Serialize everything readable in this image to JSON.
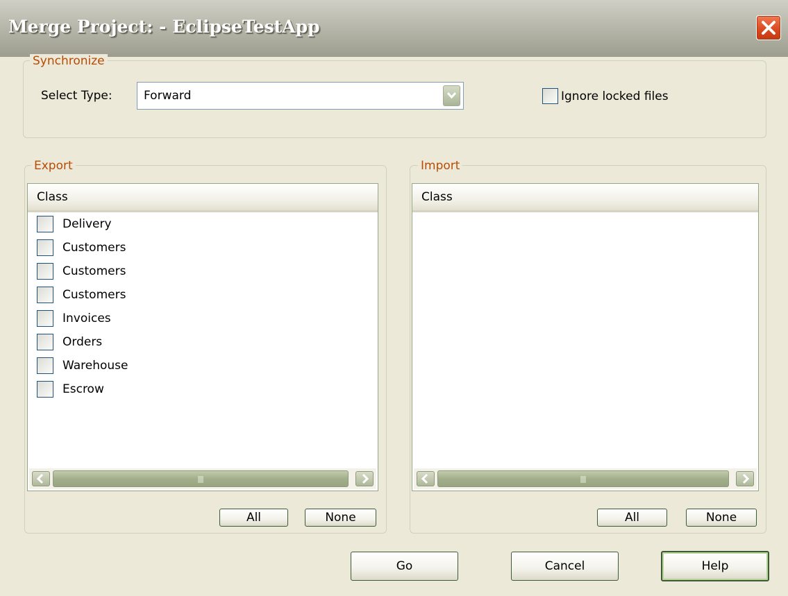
{
  "window": {
    "title": "Merge Project: - EclipseTestApp"
  },
  "synchronize": {
    "legend": "Synchronize",
    "select_type_label": "Select Type:",
    "select_type_value": "Forward",
    "ignore_locked_label": "Ignore locked files",
    "ignore_locked_checked": false
  },
  "export": {
    "legend": "Export",
    "column_header": "Class",
    "items": [
      {
        "label": "Delivery",
        "checked": false
      },
      {
        "label": "Customers",
        "checked": false
      },
      {
        "label": "Customers",
        "checked": false
      },
      {
        "label": "Customers",
        "checked": false
      },
      {
        "label": "Invoices",
        "checked": false
      },
      {
        "label": "Orders",
        "checked": false
      },
      {
        "label": "Warehouse",
        "checked": false
      },
      {
        "label": "Escrow",
        "checked": false
      }
    ],
    "all_label": "All",
    "none_label": "None"
  },
  "import": {
    "legend": "Import",
    "column_header": "Class",
    "items": [],
    "all_label": "All",
    "none_label": "None"
  },
  "footer": {
    "go_label": "Go",
    "cancel_label": "Cancel",
    "help_label": "Help"
  },
  "icons": {
    "close": "close-icon",
    "dropdown": "chevron-down-icon",
    "scroll_left": "chevron-left-icon",
    "scroll_right": "chevron-right-icon",
    "grip": "scrollbar-grip-icon"
  }
}
